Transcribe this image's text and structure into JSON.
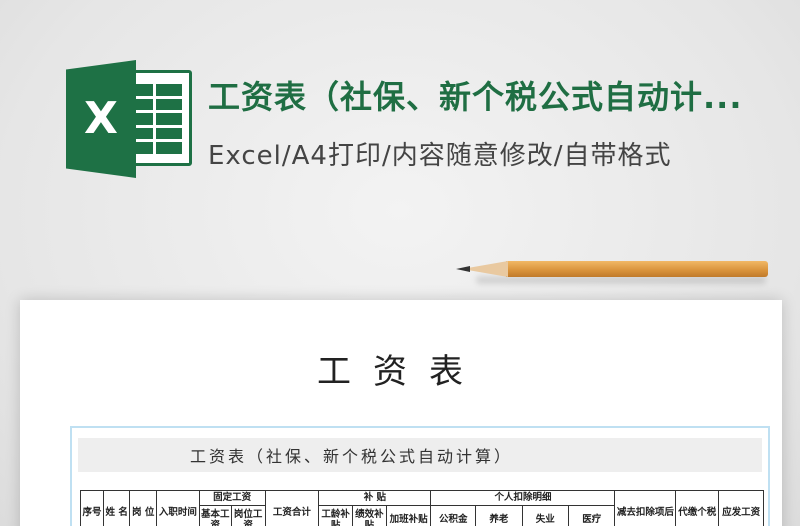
{
  "banner": {
    "title": "工资表（社保、新个税公式自动计...",
    "subtitle": "Excel/A4打印/内容随意修改/自带格式",
    "logo_letter": "X",
    "accent_color": "#1e7145"
  },
  "document": {
    "title": "工资表",
    "sheet_title": "工资表（社保、新个税公式自动计算）",
    "headers": {
      "seq": "序号",
      "name": "姓 名",
      "position": "岗 位",
      "hire_date": "入职时间",
      "fixed_salary": "固定工资",
      "base_salary": "基本工资",
      "position_salary": "岗位工资",
      "total_salary": "工资合计",
      "allowance": "补 贴",
      "seniority": "工龄补贴",
      "performance": "绩效补贴",
      "extra_allowance": "加班补贴",
      "personal_deduction": "个人扣除明细",
      "housing_fund": "公积金",
      "pension": "养老",
      "unemployment": "失业",
      "medical": "医疗",
      "minus_deduction": "减去扣除项后",
      "withheld_tax": "代缴个税",
      "payable": "应发工资"
    }
  }
}
